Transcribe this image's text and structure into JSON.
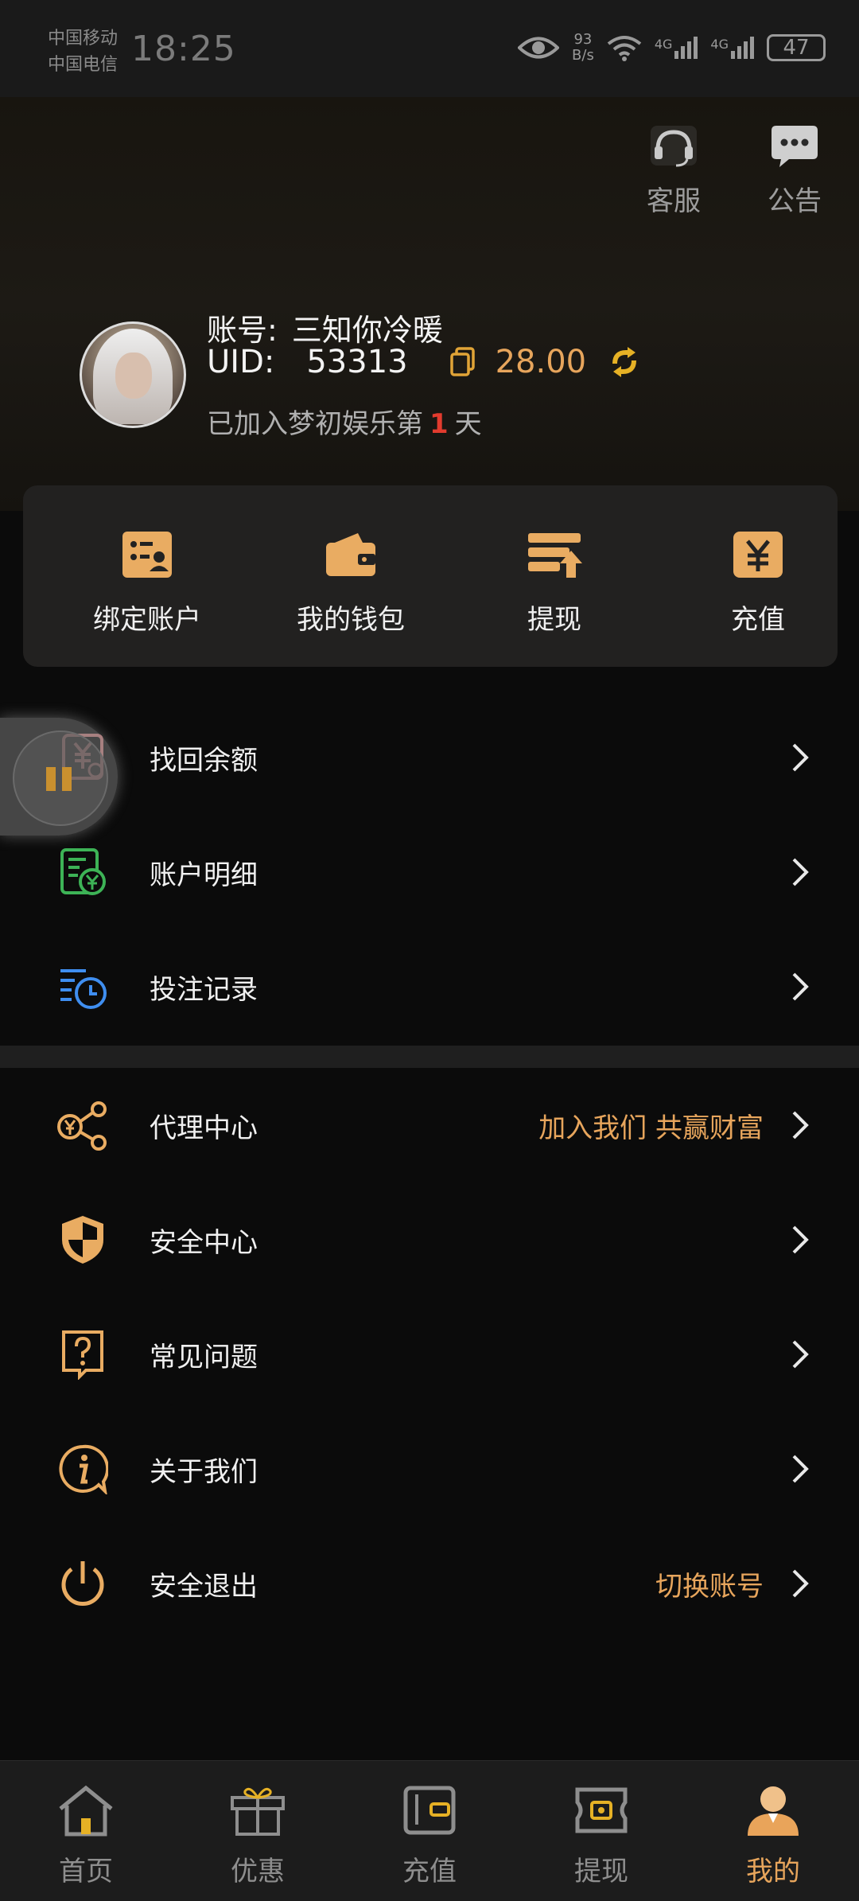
{
  "status_bar": {
    "carrier_1": "中国移动",
    "carrier_2": "中国电信",
    "time": "18:25",
    "net_speed_value": "93",
    "net_speed_unit": "B/s",
    "signal_1": "4G",
    "signal_2": "4G",
    "battery": "47"
  },
  "header": {
    "service_label": "客服",
    "notice_label": "公告"
  },
  "profile": {
    "account_label": "账号:",
    "account_name": "三知你冷暖",
    "uid_label": "UID:",
    "uid_value": "53313",
    "balance": "28.00",
    "days_prefix": "已加入梦初娱乐第",
    "days_count": "1",
    "days_suffix": "天"
  },
  "quick_actions": [
    {
      "label": "绑定账户",
      "icon": "bind-account-icon"
    },
    {
      "label": "我的钱包",
      "icon": "wallet-icon"
    },
    {
      "label": "提现",
      "icon": "withdraw-icon"
    },
    {
      "label": "充值",
      "icon": "recharge-icon"
    }
  ],
  "menu_group_1": [
    {
      "label": "找回余额",
      "icon": "recover-balance-icon"
    },
    {
      "label": "账户明细",
      "icon": "account-detail-icon"
    },
    {
      "label": "投注记录",
      "icon": "bet-record-icon"
    }
  ],
  "menu_group_2": [
    {
      "label": "代理中心",
      "extra": "加入我们 共赢财富",
      "icon": "share-icon"
    },
    {
      "label": "安全中心",
      "icon": "shield-icon"
    },
    {
      "label": "常见问题",
      "icon": "question-icon"
    },
    {
      "label": "关于我们",
      "icon": "info-icon"
    },
    {
      "label": "安全退出",
      "extra": "切换账号",
      "icon": "power-icon"
    }
  ],
  "bottom_nav": [
    {
      "label": "首页",
      "icon": "home-icon"
    },
    {
      "label": "优惠",
      "icon": "gift-icon"
    },
    {
      "label": "充值",
      "icon": "wallet-icon"
    },
    {
      "label": "提现",
      "icon": "cash-icon"
    },
    {
      "label": "我的",
      "icon": "user-icon",
      "active": true
    }
  ],
  "colors": {
    "accent": "#e7a55c",
    "background": "#0b0b0b",
    "card": "#222120",
    "highlight_red": "#e23b2e"
  }
}
